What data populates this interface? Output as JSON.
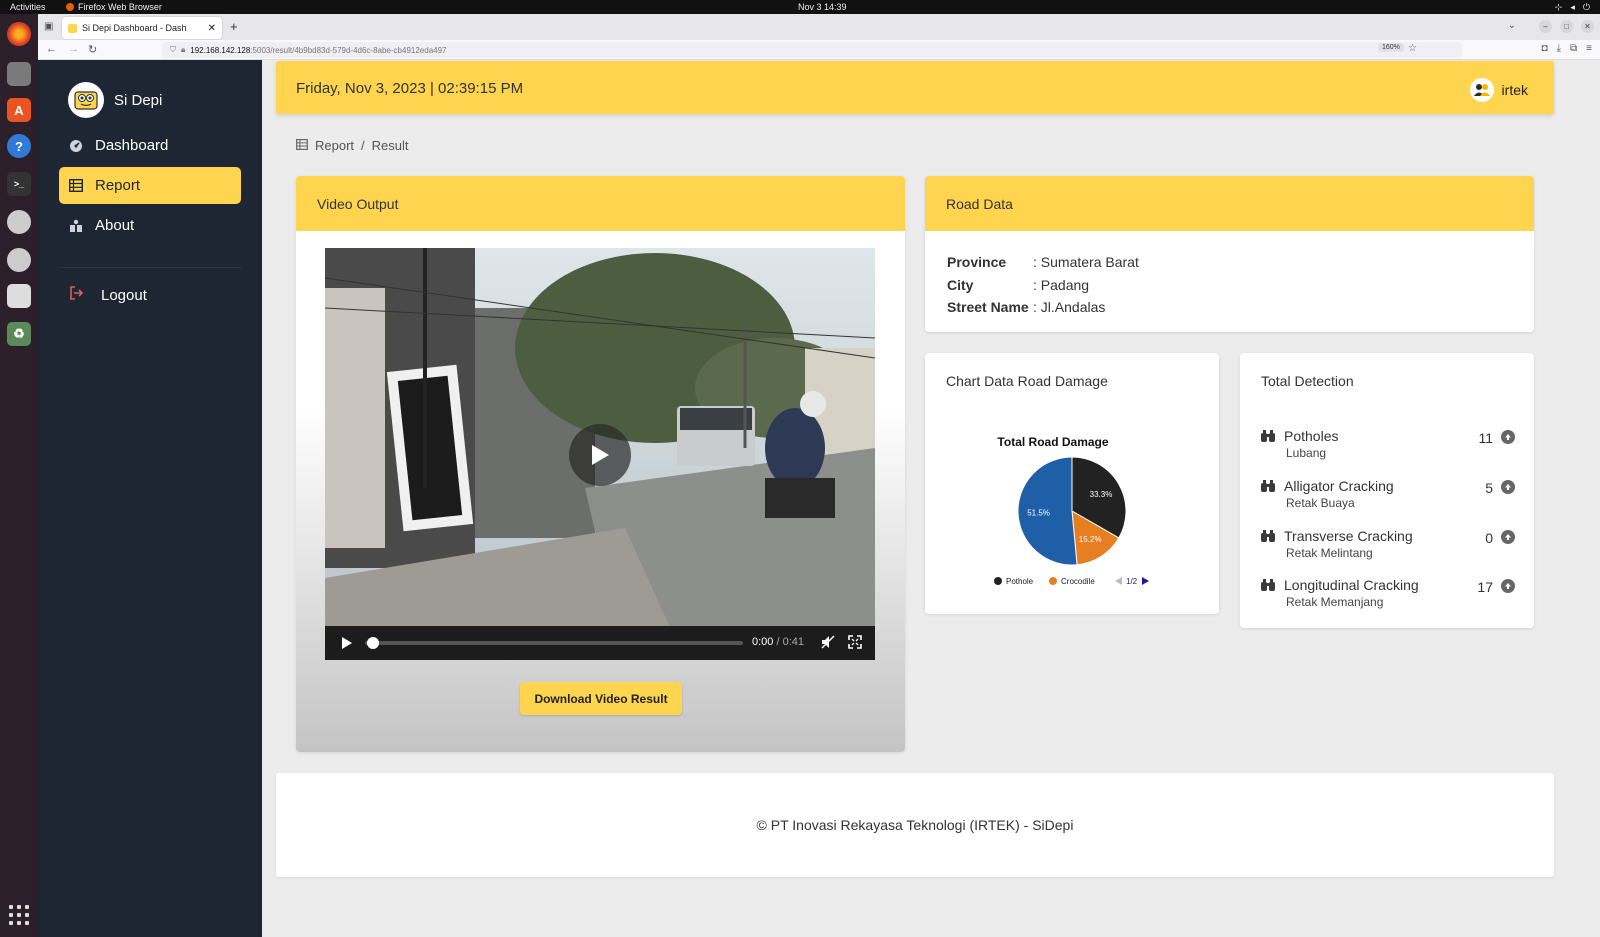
{
  "os": {
    "activities": "Activities",
    "app_name": "Firefox Web Browser",
    "clock": "Nov 3  14:39"
  },
  "browser": {
    "tab_title": "Si Depi Dashboard - Dash",
    "url_host": "192.168.142.128",
    "url_rest": ":5003/result/4b9bd83d-579d-4d6c-8abe-cb4912eda497",
    "zoom": "160%"
  },
  "sidebar": {
    "brand": "Si Depi",
    "items": [
      {
        "label": "Dashboard",
        "icon": "dashboard-icon"
      },
      {
        "label": "Report",
        "icon": "table-icon",
        "active": true
      },
      {
        "label": "About",
        "icon": "about-icon"
      }
    ],
    "logout": "Logout"
  },
  "header": {
    "datetime": "Friday, Nov 3, 2023 | 02:39:15 PM",
    "user": "irtek"
  },
  "breadcrumb": {
    "root": "Report",
    "sep": "/",
    "current": "Result"
  },
  "video_card": {
    "title": "Video Output",
    "current_time": "0:00",
    "duration": "/ 0:41",
    "download_label": "Download Video Result",
    "progress": 0
  },
  "road_card": {
    "title": "Road Data",
    "rows": [
      {
        "key": "Province",
        "value": ": Sumatera Barat"
      },
      {
        "key": "City",
        "value": ": Padang"
      },
      {
        "key": "Street Name",
        "value": ": Jl.Andalas"
      }
    ]
  },
  "chart_card": {
    "title": "Chart Data Road Damage",
    "pager": "1/2"
  },
  "chart_data": {
    "type": "pie",
    "title": "Total Road Damage",
    "series": [
      {
        "name": "Pothole",
        "value": 33.3,
        "label": "33.3%",
        "color": "#222222"
      },
      {
        "name": "Crocodile",
        "value": 15.2,
        "label": "15.2%",
        "color": "#e67e22"
      },
      {
        "name": "",
        "value": 51.5,
        "label": "51.5%",
        "color": "#1f5fa8"
      }
    ],
    "legend": [
      "Pothole",
      "Crocodile"
    ],
    "legend_position": "bottom"
  },
  "detection_card": {
    "title": "Total Detection",
    "items": [
      {
        "name": "Potholes",
        "sub": "Lubang",
        "count": "11"
      },
      {
        "name": "Alligator Cracking",
        "sub": "Retak Buaya",
        "count": "5"
      },
      {
        "name": "Transverse Cracking",
        "sub": "Retak Melintang",
        "count": "0"
      },
      {
        "name": "Longitudinal Cracking",
        "sub": "Retak Memanjang",
        "count": "17"
      }
    ]
  },
  "footer": {
    "text": "© PT Inovasi Rekayasa Teknologi (IRTEK) - SiDepi"
  },
  "colors": {
    "accent": "#ffd54f",
    "sidebar": "#1e2633"
  }
}
